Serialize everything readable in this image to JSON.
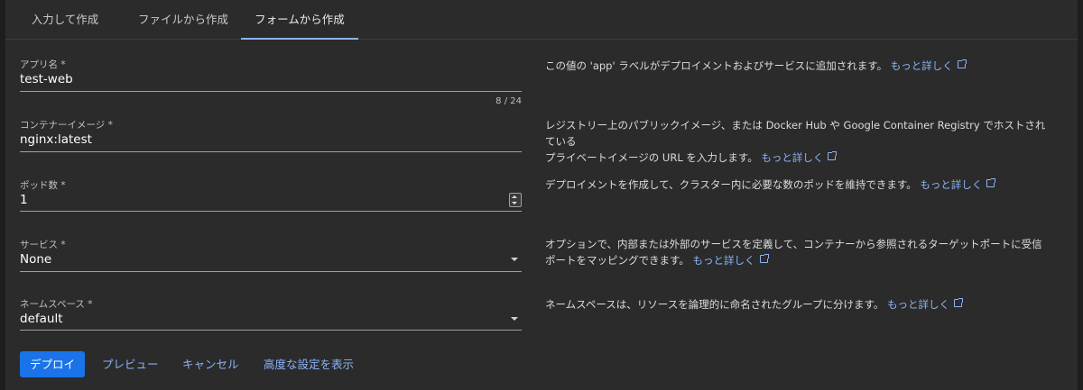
{
  "tabs": [
    {
      "label": "入力して作成"
    },
    {
      "label": "ファイルから作成"
    },
    {
      "label": "フォームから作成",
      "active": true
    }
  ],
  "form": {
    "app_name": {
      "label": "アプリ名 *",
      "value": "test-web",
      "counter": "8 / 24"
    },
    "container_image": {
      "label": "コンテナーイメージ *",
      "value": "nginx:latest"
    },
    "pod_count": {
      "label": "ポッド数 *",
      "value": "1"
    },
    "service": {
      "label": "サービス *",
      "value": "None"
    },
    "namespace": {
      "label": "ネームスペース *",
      "value": "default"
    }
  },
  "help": {
    "app_name": "この値の 'app' ラベルがデプロイメントおよびサービスに追加されます。",
    "container_image_line1": "レジストリー上のパブリックイメージ、または Docker Hub や Google Container Registry でホストされている",
    "container_image_line2": "プライベートイメージの URL を入力します。",
    "pod_count": "デプロイメントを作成して、クラスター内に必要な数のポッドを維持できます。",
    "service_line1": "オプションで、内部または外部のサービスを定義して、コンテナーから参照されるターゲットポートに受信",
    "service_line2": "ポートをマッピングできます。",
    "namespace": "ネームスペースは、リソースを論理的に命名されたグループに分けます。",
    "learn_more": "もっと詳しく"
  },
  "actions": {
    "deploy": "デプロイ",
    "preview": "プレビュー",
    "cancel": "キャンセル",
    "advanced": "高度な設定を表示"
  },
  "colors": {
    "background": "#2b2b2b",
    "accent": "#8ab4f8",
    "primary_button": "#1a73e8"
  }
}
